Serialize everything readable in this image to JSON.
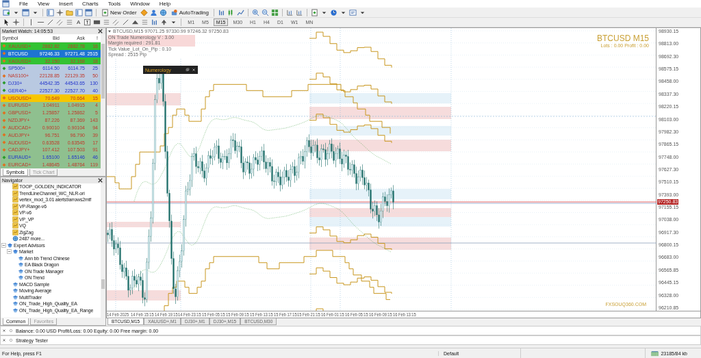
{
  "menu": [
    "File",
    "View",
    "Insert",
    "Charts",
    "Tools",
    "Window",
    "Help"
  ],
  "toolbar": {
    "new_order": "New Order",
    "autotrading": "AutoTrading",
    "text_tool": "A",
    "timeframes": [
      {
        "label": "M1",
        "selected": false
      },
      {
        "label": "M5",
        "selected": false
      },
      {
        "label": "M15",
        "selected": true
      },
      {
        "label": "M30",
        "selected": false
      },
      {
        "label": "H1",
        "selected": false
      },
      {
        "label": "H4",
        "selected": false
      },
      {
        "label": "D1",
        "selected": false
      },
      {
        "label": "W1",
        "selected": false
      },
      {
        "label": "MN",
        "selected": false
      }
    ]
  },
  "market_watch": {
    "title": "Market Watch: 14:05:53",
    "columns": [
      "Symbol",
      "Bid",
      "Ask",
      "!"
    ],
    "rows": [
      {
        "symbol": "XAUUSD+",
        "bid": "2882.82",
        "ask": "2882.78",
        "spread": "16",
        "rising": false,
        "color": "#33c233",
        "selected": false
      },
      {
        "symbol": "BTCUSD",
        "bid": "97246.33",
        "ask": "97271.48",
        "spread": "2515",
        "rising": false,
        "color": "#1e74d2",
        "selected": true
      },
      {
        "symbol": "XAGUSD+",
        "bid": "32.150",
        "ask": "32.168",
        "spread": "18",
        "rising": false,
        "color": "#33c233",
        "selected": false
      },
      {
        "symbol": "SP500+",
        "bid": "6114.50",
        "ask": "6114.75",
        "spread": "25",
        "rising": true,
        "color": "#b9c9e1",
        "selected": false
      },
      {
        "symbol": "NAS100+",
        "bid": "22128.85",
        "ask": "22129.35",
        "spread": "50",
        "rising": false,
        "color": "#b9c9e1",
        "selected": false
      },
      {
        "symbol": "DJ30+",
        "bid": "44542.35",
        "ask": "44543.65",
        "spread": "130",
        "rising": true,
        "color": "#b9c9e1",
        "selected": false
      },
      {
        "symbol": "GER40+",
        "bid": "22527.30",
        "ask": "22527.70",
        "spread": "40",
        "rising": true,
        "color": "#b9c9e1",
        "selected": false
      },
      {
        "symbol": "USOUSD+",
        "bid": "70.649",
        "ask": "70.664",
        "spread": "15",
        "rising": false,
        "color": "#f7c600",
        "selected": false
      },
      {
        "symbol": "EURUSD+",
        "bid": "1.04911",
        "ask": "1.04915",
        "spread": "4",
        "rising": false,
        "color": "#8fc08f",
        "selected": false
      },
      {
        "symbol": "GBPUSD+",
        "bid": "1.25857",
        "ask": "1.25862",
        "spread": "5",
        "rising": false,
        "color": "#8fc08f",
        "selected": false
      },
      {
        "symbol": "NZDJPY+",
        "bid": "87.226",
        "ask": "87.369",
        "spread": "143",
        "rising": false,
        "color": "#8fc08f",
        "selected": false
      },
      {
        "symbol": "AUDCAD+",
        "bid": "0.90010",
        "ask": "0.90104",
        "spread": "94",
        "rising": false,
        "color": "#8fc08f",
        "selected": false
      },
      {
        "symbol": "AUDJPY+",
        "bid": "96.751",
        "ask": "96.790",
        "spread": "39",
        "rising": false,
        "color": "#8fc08f",
        "selected": false
      },
      {
        "symbol": "AUDUSD+",
        "bid": "0.63528",
        "ask": "0.63545",
        "spread": "17",
        "rising": false,
        "color": "#8fc08f",
        "selected": false
      },
      {
        "symbol": "CADJPY+",
        "bid": "107.412",
        "ask": "107.503",
        "spread": "91",
        "rising": false,
        "color": "#8fc08f",
        "selected": false
      },
      {
        "symbol": "EURAUD+",
        "bid": "1.65100",
        "ask": "1.65146",
        "spread": "46",
        "rising": true,
        "color": "#8fc08f",
        "selected": false
      },
      {
        "symbol": "EURCAD+",
        "bid": "1.48645",
        "ask": "1.48764",
        "spread": "119",
        "rising": false,
        "color": "#8fc08f",
        "selected": false
      }
    ],
    "tabs": [
      {
        "label": "Symbols",
        "selected": true
      },
      {
        "label": "Tick Chart",
        "selected": false
      }
    ]
  },
  "navigator": {
    "title": "Navigator",
    "tree": [
      {
        "children": [
          {
            "label": "TOOP_GOLDEN_INDICATOR",
            "kind": "indicator"
          },
          {
            "label": "TrendLineChannel_WC_NLR-ori",
            "kind": "indicator"
          },
          {
            "label": "vertex_mod_3.01 alerts9arrows2mtf",
            "kind": "indicator"
          },
          {
            "label": "VP-Range-v6",
            "kind": "indicator"
          },
          {
            "label": "VP-v6",
            "kind": "indicator"
          },
          {
            "label": "VP_VP",
            "kind": "indicator"
          },
          {
            "label": "VQ",
            "kind": "indicator"
          },
          {
            "label": "ZigZag",
            "kind": "indicator"
          },
          {
            "label": "2487 more...",
            "kind": "more"
          }
        ]
      },
      {
        "label": "Expert Advisors",
        "kind": "folder",
        "expanded": true,
        "children": [
          {
            "label": "Market",
            "kind": "folder",
            "expanded": true,
            "children": [
              {
                "label": "Ann bb Trend Chinese",
                "kind": "expert"
              },
              {
                "label": "EA Black Dragon",
                "kind": "expert"
              },
              {
                "label": "ON Trade Manager",
                "kind": "expert"
              },
              {
                "label": "ON Trend",
                "kind": "expert"
              }
            ]
          },
          {
            "label": "MACD Sample",
            "kind": "expert"
          },
          {
            "label": "Moving Average",
            "kind": "expert"
          },
          {
            "label": "MultiTrader",
            "kind": "expert"
          },
          {
            "label": "ON_Trade_High_Quality_EA",
            "kind": "expert"
          },
          {
            "label": "ON_Trade_High_Quality_EA_Range",
            "kind": "expert"
          }
        ]
      }
    ],
    "tabs": [
      {
        "label": "Common",
        "selected": true
      },
      {
        "label": "Favorites",
        "selected": false
      }
    ]
  },
  "chart": {
    "header": "BTCUSD,M15 97071.25 97330.99 97246.32 97250.83",
    "info": [
      {
        "text": "ON Trade Numerology V : 3.00",
        "highlighted": true
      },
      {
        "text": "Margin required : 291.81",
        "highlighted": true
      },
      {
        "text": "Tick Value_Lot_On_Pip : 0.10",
        "highlighted": false
      },
      {
        "text": "Spread : 2515 Pip",
        "highlighted": false
      }
    ],
    "panel": {
      "title": "Numerology"
    },
    "symbol_label": "BTCUSD M15",
    "lots_label": "Lots : 0.00 Profit : 0.00",
    "site_label": "FXSOUQ360.COM",
    "price_labels": [
      "98930.15",
      "98813.00",
      "98692.30",
      "98575.15",
      "98458.00",
      "98337.30",
      "98220.15",
      "98103.00",
      "97982.30",
      "97865.15",
      "97748.00",
      "97627.30",
      "97510.15",
      "97393.00",
      "97155.15",
      "97038.00",
      "96917.30",
      "96800.15",
      "96683.00",
      "96565.85",
      "96445.15",
      "96328.00",
      "96210.85"
    ],
    "current_price": "97250.83",
    "time_labels": [
      "14 Feb 2025",
      "14 Feb 15:15",
      "14 Feb 19:15",
      "14 Feb 23:15",
      "15 Feb 05:15",
      "15 Feb 09:15",
      "15 Feb 13:15",
      "15 Feb 17:15",
      "15 Feb 21:15",
      "16 Feb 01:15",
      "16 Feb 05:15",
      "16 Feb 09:15",
      "16 Feb 13:15"
    ]
  },
  "chart_tabs": [
    {
      "label": "BTCUSD,M15",
      "selected": true
    },
    {
      "label": "XAUUSD+,M1",
      "selected": false
    },
    {
      "label": "DJ30+,M1",
      "selected": false
    },
    {
      "label": "DJ30+,M15",
      "selected": false
    },
    {
      "label": "BTCUSD,M30",
      "selected": false
    }
  ],
  "terminal": {
    "summary": "Balance: 0.00 USD  Profit/Loss: 0.00  Equity: 0.00  Free margin: 0.00"
  },
  "strategy_tester": {
    "title": "Strategy Tester"
  },
  "status_bar": {
    "help": "For Help, press F1",
    "profile": "Default",
    "traffic": "23185/84 kb"
  }
}
